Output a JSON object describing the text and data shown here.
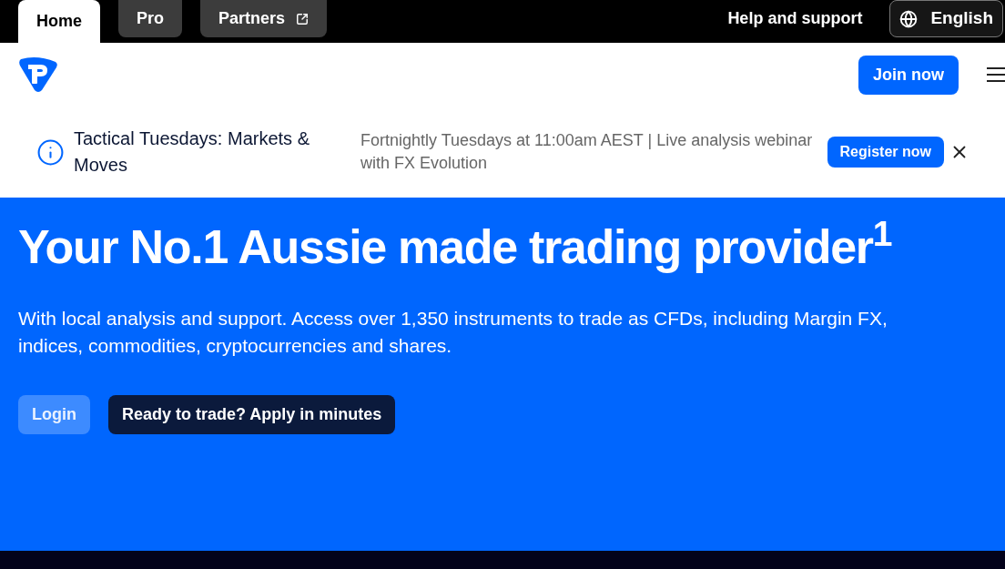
{
  "top_bar": {
    "tabs": [
      {
        "label": "Home",
        "selected": true,
        "external": false
      },
      {
        "label": "Pro",
        "selected": false,
        "external": false
      },
      {
        "label": "Partners",
        "selected": false,
        "external": true
      }
    ],
    "help_link": "Help and support",
    "language": "English"
  },
  "header": {
    "join_button": "Join now"
  },
  "announcement": {
    "title": "Tactical Tuesdays: Markets & Moves",
    "subtitle": "Fortnightly Tuesdays at 11:00am AEST | Live analysis webinar with FX Evolution",
    "register_button": "Register now"
  },
  "hero": {
    "heading": "Your No.1 Aussie made trading provider$^{1}$",
    "text": "With local analysis and support. Access over 1,350 instruments to trade as CFDs, including Margin FX, indices, commodities, cryptocurrencies and shares.",
    "buttons": [
      {
        "label": "Login",
        "kind": "secondary"
      },
      {
        "label": "Ready to trade? Apply in minutes",
        "kind": "primary"
      }
    ]
  }
}
